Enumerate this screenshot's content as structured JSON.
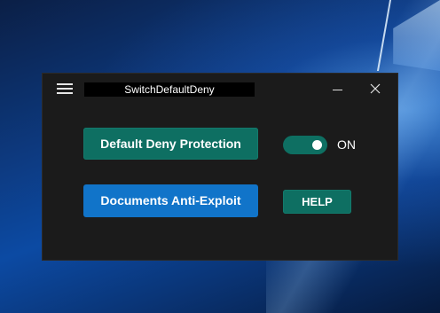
{
  "window": {
    "title": "SwitchDefaultDeny"
  },
  "titlebar": {
    "menu_icon": "hamburger-menu-icon",
    "minimize_icon": "minimize-icon",
    "close_icon": "close-icon",
    "close_glyph": "✕"
  },
  "main": {
    "deny_button_label": "Default Deny Protection",
    "toggle_state": "ON",
    "toggle_on": true,
    "exploit_button_label": "Documents Anti-Exploit",
    "help_button_label": "HELP"
  },
  "colors": {
    "window_bg": "#1b1b1b",
    "teal": "#0e6f62",
    "blue": "#1174c9"
  }
}
